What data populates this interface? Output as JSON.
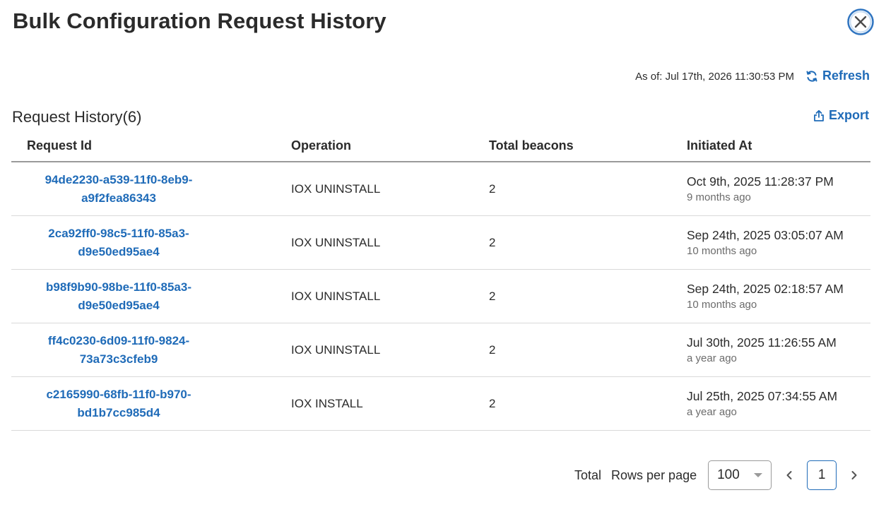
{
  "header": {
    "title": "Bulk Configuration Request History"
  },
  "toolbar": {
    "as_of": "As of: Jul 17th, 2026 11:30:53 PM",
    "refresh_label": "Refresh",
    "export_label": "Export"
  },
  "section": {
    "title": "Request History(6)"
  },
  "table": {
    "columns": [
      "Request Id",
      "Operation",
      "Total beacons",
      "Initiated At"
    ],
    "rows": [
      {
        "id_line1": "94de2230-a539-11f0-8eb9-",
        "id_line2": "a9f2fea86343",
        "operation": "IOX UNINSTALL",
        "total": "2",
        "initiated": "Oct 9th, 2025 11:28:37 PM",
        "relative": "9 months ago"
      },
      {
        "id_line1": "2ca92ff0-98c5-11f0-85a3-",
        "id_line2": "d9e50ed95ae4",
        "operation": "IOX UNINSTALL",
        "total": "2",
        "initiated": "Sep 24th, 2025 03:05:07 AM",
        "relative": "10 months ago"
      },
      {
        "id_line1": "b98f9b90-98be-11f0-85a3-",
        "id_line2": "d9e50ed95ae4",
        "operation": "IOX UNINSTALL",
        "total": "2",
        "initiated": "Sep 24th, 2025 02:18:57 AM",
        "relative": "10 months ago"
      },
      {
        "id_line1": "ff4c0230-6d09-11f0-9824-",
        "id_line2": "73a73c3cfeb9",
        "operation": "IOX UNINSTALL",
        "total": "2",
        "initiated": "Jul 30th, 2025 11:26:55 AM",
        "relative": "a year ago"
      },
      {
        "id_line1": "c2165990-68fb-11f0-b970-",
        "id_line2": "bd1b7cc985d4",
        "operation": "IOX INSTALL",
        "total": "2",
        "initiated": "Jul 25th, 2025 07:34:55 AM",
        "relative": "a year ago"
      }
    ]
  },
  "pagination": {
    "total_label": "Total",
    "rows_per_page_label": "Rows per page",
    "rows_per_page_value": "100",
    "current_page": "1"
  },
  "icons": {
    "close": "close-circle-icon",
    "refresh": "refresh-icon",
    "export": "export-icon",
    "dropdown": "caret-down-icon",
    "prev": "chevron-left-icon",
    "next": "chevron-right-icon"
  },
  "colors": {
    "accent": "#1f6bb8",
    "text": "#2b2b2b",
    "muted": "#6b6b6b",
    "border": "#d9d9d9"
  }
}
